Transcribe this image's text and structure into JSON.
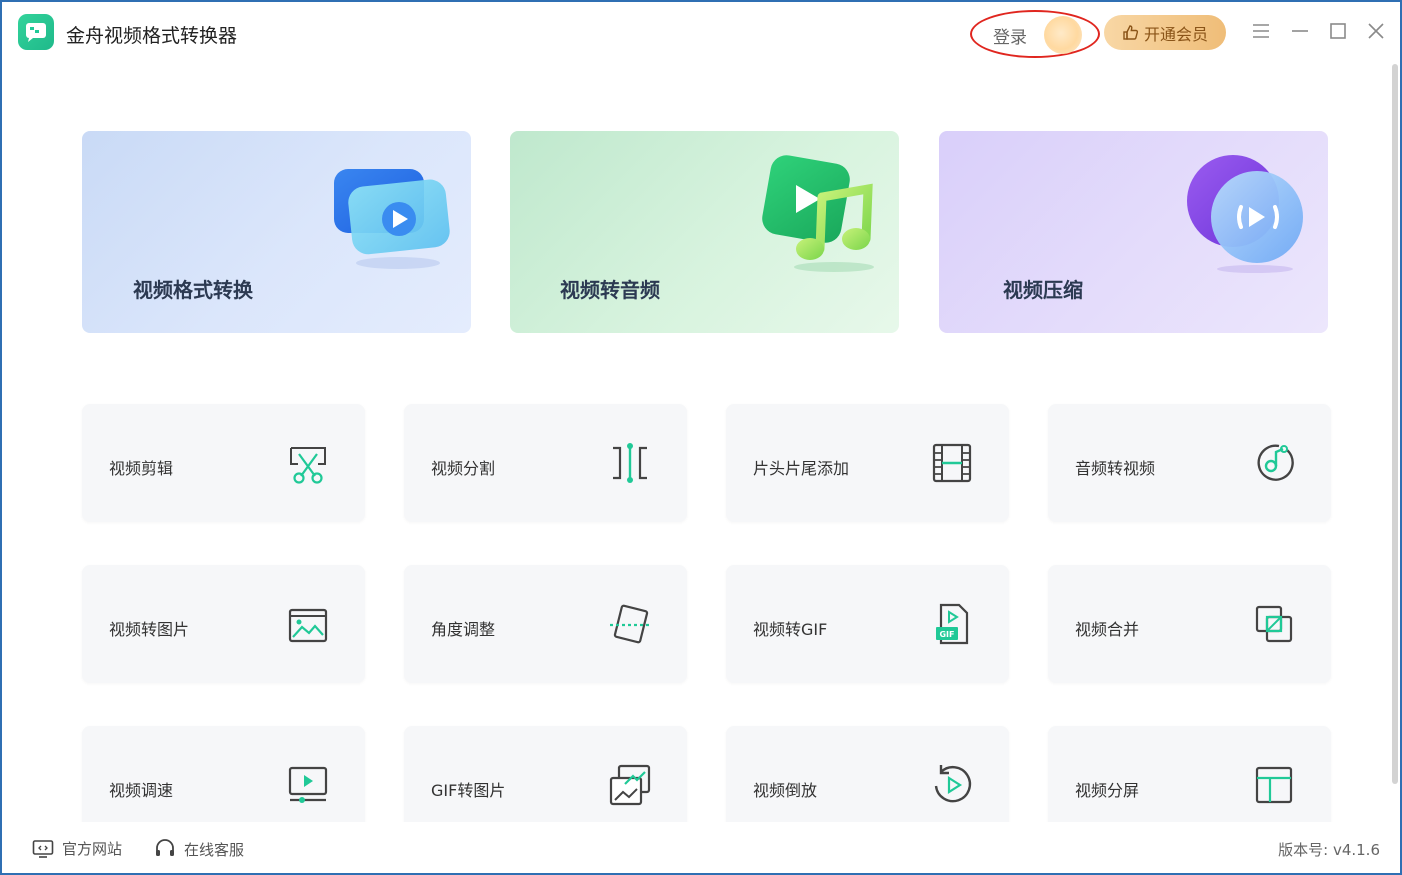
{
  "app": {
    "title": "金舟视频格式转换器"
  },
  "header": {
    "login_label": "登录",
    "vip_label": "开通会员"
  },
  "features": [
    {
      "label": "视频格式转换",
      "icon": "video-play-icon"
    },
    {
      "label": "视频转音频",
      "icon": "music-note-icon"
    },
    {
      "label": "视频压缩",
      "icon": "compress-icon"
    }
  ],
  "tools": [
    {
      "label": "视频剪辑",
      "icon": "scissors-icon"
    },
    {
      "label": "视频分割",
      "icon": "split-icon"
    },
    {
      "label": "片头片尾添加",
      "icon": "film-icon"
    },
    {
      "label": "音频转视频",
      "icon": "music-disc-icon"
    },
    {
      "label": "视频转图片",
      "icon": "image-icon"
    },
    {
      "label": "角度调整",
      "icon": "rotate-angle-icon"
    },
    {
      "label": "视频转GIF",
      "icon": "gif-file-icon"
    },
    {
      "label": "视频合并",
      "icon": "merge-icon"
    },
    {
      "label": "视频调速",
      "icon": "speed-screen-icon"
    },
    {
      "label": "GIF转图片",
      "icon": "gif-to-image-icon"
    },
    {
      "label": "视频倒放",
      "icon": "reverse-play-icon"
    },
    {
      "label": "视频分屏",
      "icon": "split-screen-icon"
    }
  ],
  "footer": {
    "website_label": "官方网站",
    "support_label": "在线客服",
    "version_label": "版本号: v4.1.6"
  },
  "colors": {
    "accent_green": "#20c997",
    "login_highlight": "#e0261f",
    "vip_gold": "#efbd78",
    "window_border": "#2f6fb3"
  }
}
